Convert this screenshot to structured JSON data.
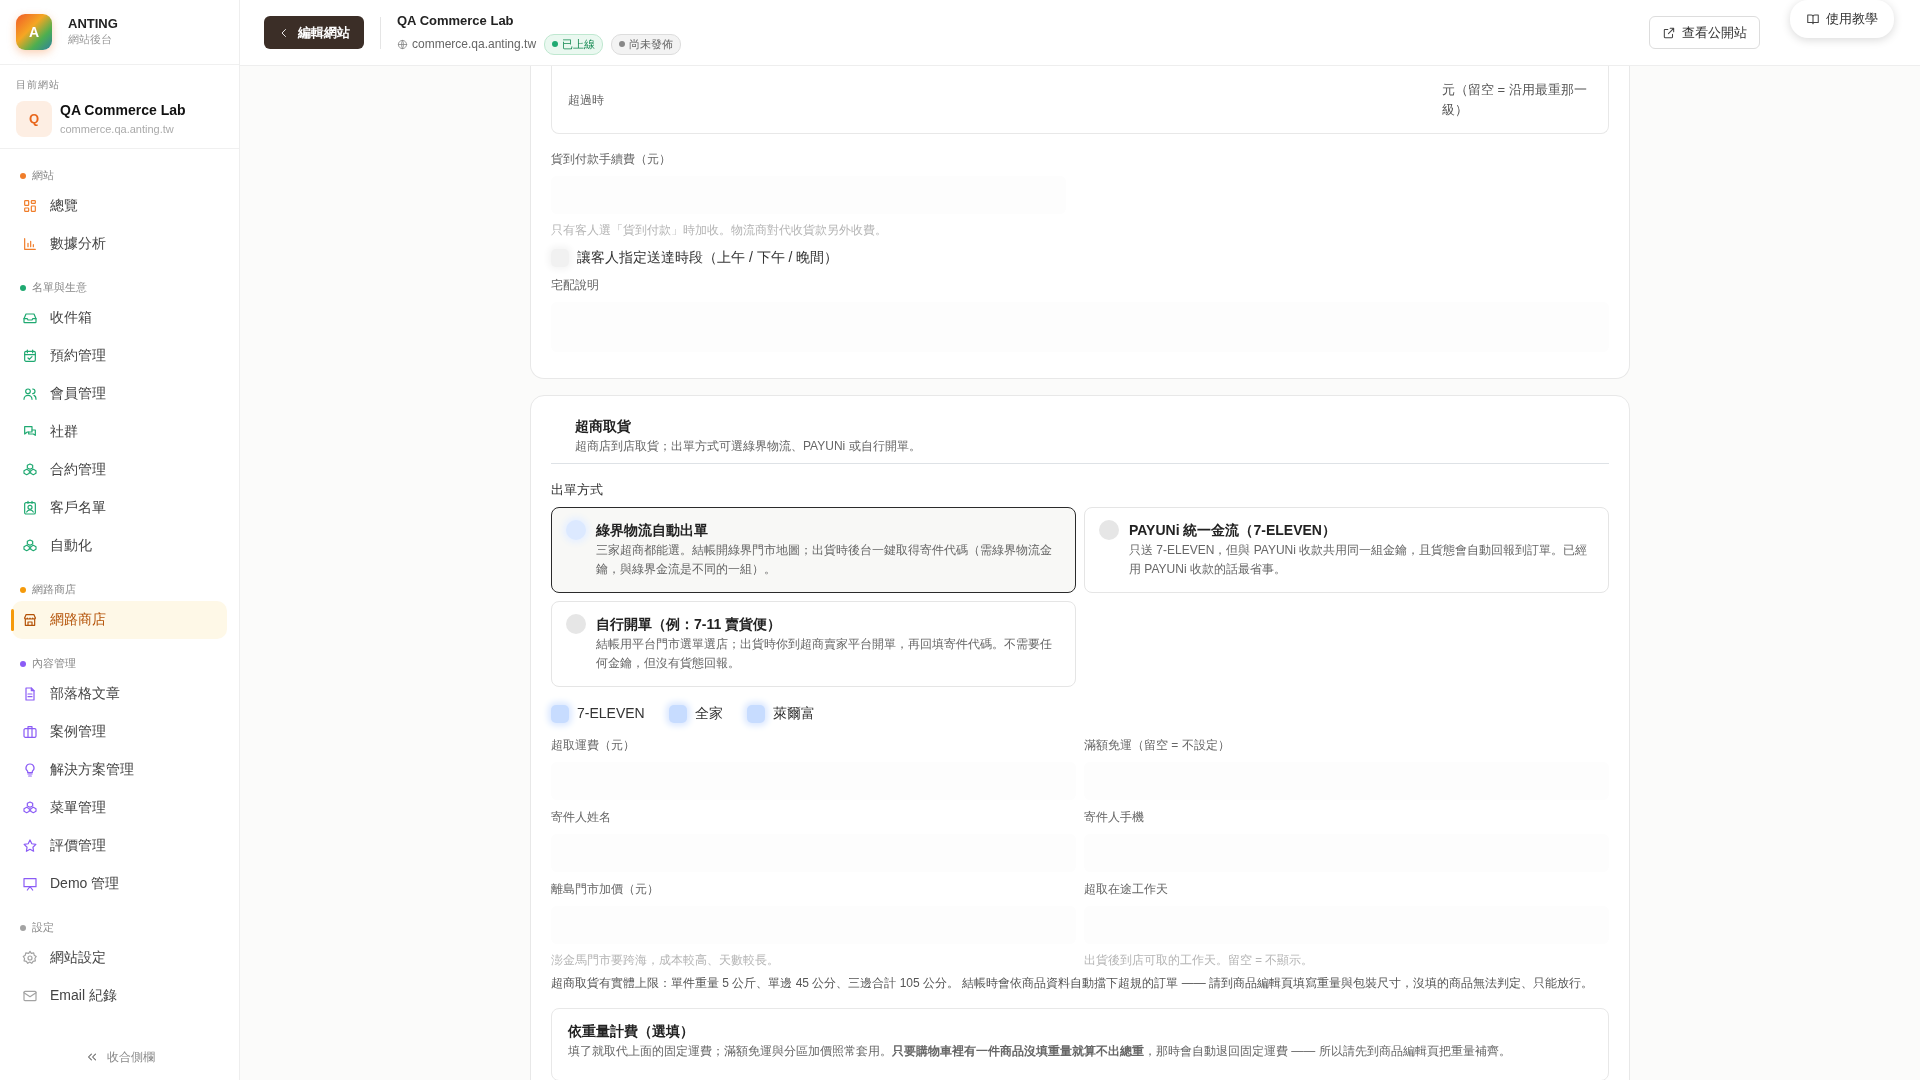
{
  "sidebar": {
    "brand": {
      "logo_letter": "A",
      "name": "ANTING",
      "subtitle": "網站後台"
    },
    "current_site": {
      "label": "目前網站",
      "letter": "Q",
      "name": "QA Commerce Lab",
      "domain": "commerce.qa.anting.tw"
    },
    "sections": [
      {
        "title": "網站",
        "color": "#f07d2a",
        "items": [
          {
            "label": "總覽",
            "selected": false
          },
          {
            "label": "數據分析",
            "selected": false
          }
        ]
      },
      {
        "title": "名單與生意",
        "color": "#1fa971",
        "items": [
          {
            "label": "收件箱",
            "selected": false
          },
          {
            "label": "預約管理",
            "selected": false
          },
          {
            "label": "會員管理",
            "selected": false
          },
          {
            "label": "社群",
            "selected": false
          },
          {
            "label": "合約管理",
            "selected": false
          },
          {
            "label": "客戶名單",
            "selected": false
          },
          {
            "label": "自動化",
            "selected": false
          }
        ]
      },
      {
        "title": "網路商店",
        "color": "#f59a0b",
        "items": [
          {
            "label": "網路商店",
            "selected": true
          }
        ]
      },
      {
        "title": "內容管理",
        "color": "#8b5cf6",
        "items": [
          {
            "label": "部落格文章",
            "selected": false
          },
          {
            "label": "案例管理",
            "selected": false
          },
          {
            "label": "解決方案管理",
            "selected": false
          },
          {
            "label": "菜單管理",
            "selected": false
          },
          {
            "label": "評價管理",
            "selected": false
          },
          {
            "label": "Demo 管理",
            "selected": false
          }
        ]
      },
      {
        "title": "設定",
        "color": "#a3a3a3",
        "items": [
          {
            "label": "網站設定",
            "selected": false
          },
          {
            "label": "Email 紀錄",
            "selected": false
          }
        ]
      }
    ],
    "collapse_label": "收合側欄"
  },
  "topbar": {
    "back_button": "編輯網站",
    "site_title": "QA Commerce Lab",
    "url": "commerce.qa.anting.tw",
    "badges": [
      {
        "label": "已上線",
        "kind": "live"
      },
      {
        "label": "尚未發佈",
        "kind": "draft"
      }
    ],
    "view_button": "查看公開站",
    "help_button": "使用教學"
  },
  "delivery": {
    "overflow_label": "超過時",
    "overflow_suffix": "元（留空 = 沿用最重那一級）",
    "cod_label": "貨到付款手續費（元）",
    "cod_help": "只有客人選「貨到付款」時加收。物流商對代收貨款另外收費。",
    "time_slot": {
      "label": "讓客人指定送達時段（上午 / 下午 / 晚間）",
      "checked": false
    },
    "notes_label": "宅配說明"
  },
  "cvs": {
    "title": "超商取貨",
    "description": "超商店到店取貨；出單方式可選綠界物流、PAYUNi 或自行開單。",
    "method_label": "出單方式",
    "methods": [
      {
        "title": "綠界物流自動出單",
        "description": "三家超商都能選。結帳開綠界門市地圖；出貨時後台一鍵取得寄件代碼（需綠界物流金鑰，與綠界金流是不同的一組）。",
        "selected": true
      },
      {
        "title": "PAYUNi 統一金流（7-ELEVEN）",
        "description": "只送 7-ELEVEN，但與 PAYUNi 收款共用同一組金鑰，且貨態會自動回報到訂單。已經用 PAYUNi 收款的話最省事。",
        "selected": false
      },
      {
        "title": "自行開單（例：7-11 賣貨便）",
        "description": "結帳用平台門市選單選店；出貨時你到超商賣家平台開單，再回填寄件代碼。不需要任何金鑰，但沒有貨態回報。",
        "selected": false
      }
    ],
    "stores": [
      {
        "label": "7-ELEVEN",
        "checked": true
      },
      {
        "label": "全家",
        "checked": true
      },
      {
        "label": "萊爾富",
        "checked": true
      }
    ],
    "fields": [
      {
        "label": "超取運費（元）"
      },
      {
        "label": "滿額免運（留空 = 不設定）"
      },
      {
        "label": "寄件人姓名"
      },
      {
        "label": "寄件人手機"
      },
      {
        "label": "離島門市加價（元）",
        "help": "澎金馬門市要跨海，成本較高、天數較長。"
      },
      {
        "label": "超取在途工作天",
        "help": "出貨後到店可取的工作天。留空 = 不顯示。"
      }
    ],
    "note": "超商取貨有實體上限：單件重量 5 公斤、單邊 45 公分、三邊合計 105 公分。 結帳時會依商品資料自動擋下超規的訂單 —— 請到商品編輯頁填寫重量與包裝尺寸，沒填的商品無法判定、只能放行。",
    "weight": {
      "title": "依重量計費（選填）",
      "description": "填了就取代上面的固定運費；滿額免運與分區加價照常套用。**只要購物車裡有一件商品沒填重量就算不出總重**，那時會自動退回固定運費 —— 所以請先到商品編輯頁把重量補齊。"
    }
  }
}
